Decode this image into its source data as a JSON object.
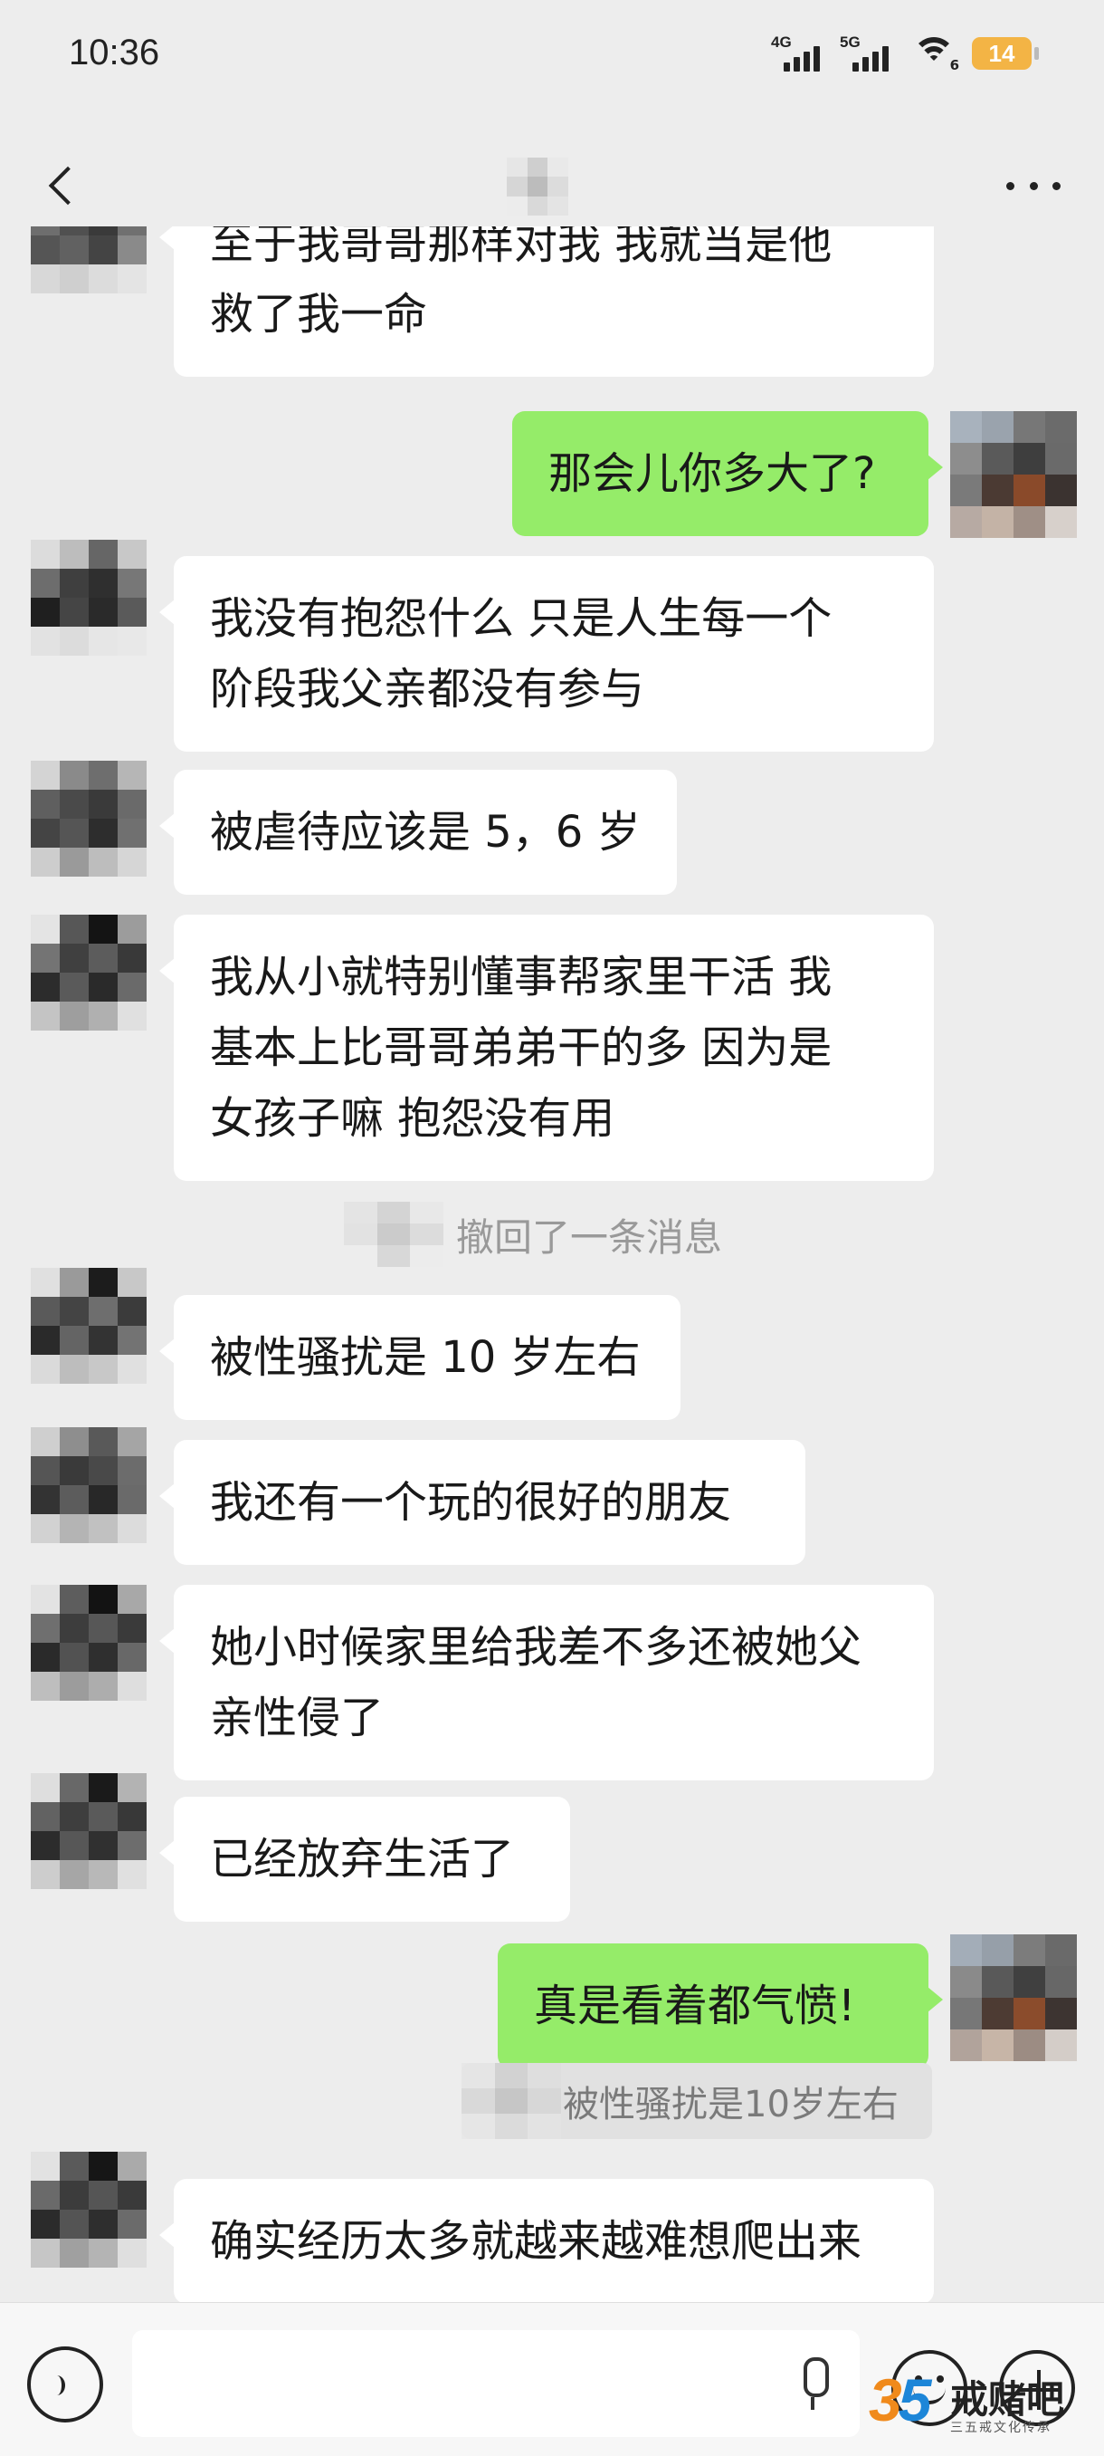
{
  "status_bar": {
    "time": "10:36",
    "network_1": "4G",
    "network_2": "5G",
    "wifi_sub": "6",
    "battery": "14"
  },
  "header": {
    "back_icon": "chevron-left-icon",
    "more_icon": "more-dots-icon"
  },
  "messages": [
    {
      "side": "left",
      "text": "至于我哥哥那样对我   我就当是他\n救了我一命"
    },
    {
      "side": "right",
      "text": "那会儿你多大了?"
    },
    {
      "side": "left",
      "text": "我没有抱怨什么   只是人生每一个\n阶段我父亲都没有参与"
    },
    {
      "side": "left",
      "text": "被虐待应该是 5，6 岁"
    },
    {
      "side": "left",
      "text": "我从小就特别懂事帮家里干活   我\n基本上比哥哥弟弟干的多   因为是\n女孩子嘛    抱怨没有用"
    },
    {
      "side": "left",
      "text": "被性骚扰是 10 岁左右"
    },
    {
      "side": "left",
      "text": "我还有一个玩的很好的朋友"
    },
    {
      "side": "left",
      "text": "她小时候家里给我差不多还被她父\n亲性侵了"
    },
    {
      "side": "left",
      "text": "已经放弃生活了"
    },
    {
      "side": "right",
      "text": "真是看着都气愤!"
    },
    {
      "side": "left",
      "text": "确实经历太多就越来越难想爬出来"
    }
  ],
  "system_note": "撤回了一条消息",
  "quote_text": "被性骚扰是10岁左右",
  "input": {
    "voice_icon": "voice-mode-icon",
    "mic_icon": "microphone-icon",
    "emoji_icon": "emoji-icon",
    "plus_icon": "plus-icon"
  },
  "watermark": {
    "number": "35",
    "name": "戒赌吧",
    "subtitle": "三五戒文化传承"
  }
}
